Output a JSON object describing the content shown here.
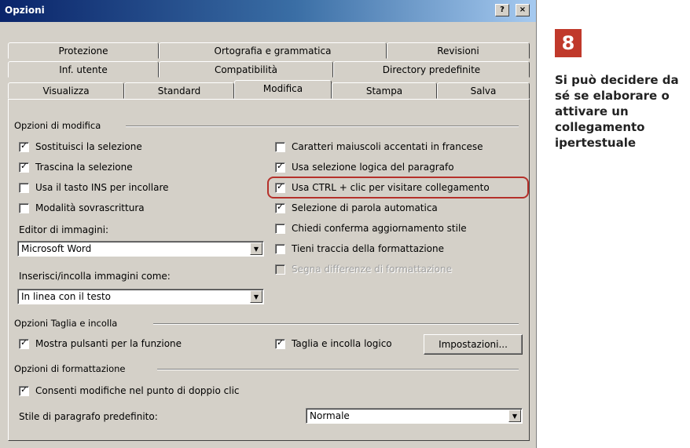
{
  "dialog": {
    "title": "Opzioni",
    "help_button": "?",
    "close_button": "×"
  },
  "tabs": {
    "row1": [
      "Protezione",
      "Ortografia e grammatica",
      "Revisioni"
    ],
    "row2": [
      "Inf. utente",
      "Compatibilità",
      "Directory predefinite"
    ],
    "row3": [
      "Visualizza",
      "Standard",
      "Modifica",
      "Stampa",
      "Salva"
    ],
    "active": "Modifica"
  },
  "groups": {
    "modifica": {
      "title": "Opzioni di modifica",
      "left": [
        {
          "label": "Sostituisci la selezione",
          "checked": true
        },
        {
          "label": "Trascina la selezione",
          "checked": true
        },
        {
          "label": "Usa il tasto INS per incollare",
          "checked": false
        },
        {
          "label": "Modalità sovrascrittura",
          "checked": false
        }
      ],
      "right": [
        {
          "label": "Caratteri maiuscoli accentati in francese",
          "checked": false
        },
        {
          "label": "Usa selezione logica del paragrafo",
          "checked": true
        },
        {
          "label": "Usa CTRL + clic per visitare collegamento",
          "checked": true
        },
        {
          "label": "Selezione di parola automatica",
          "checked": true
        },
        {
          "label": "Chiedi conferma aggiornamento stile",
          "checked": false
        },
        {
          "label": "Tieni traccia della formattazione",
          "checked": false
        },
        {
          "label": "Segna differenze di formattazione",
          "checked": false,
          "disabled": true
        }
      ],
      "editor_label": "Editor di immagini:",
      "editor_value": "Microsoft Word",
      "insert_label": "Inserisci/incolla immagini come:",
      "insert_value": "In linea con il testo"
    },
    "taglia": {
      "title": "Opzioni Taglia e incolla",
      "show_buttons": {
        "label": "Mostra pulsanti per la funzione",
        "checked": true
      },
      "smart_cut": {
        "label": "Taglia e incolla logico",
        "checked": true
      },
      "settings_button": "Impostazioni..."
    },
    "formattazione": {
      "title": "Opzioni di formattazione",
      "double_click": {
        "label": "Consenti modifiche nel punto di doppio clic",
        "checked": true
      },
      "style_label": "Stile di paragrafo predefinito:",
      "style_value": "Normale"
    }
  },
  "callout": {
    "number": "8",
    "text": "Si può decidere da sé se elaborare o attivare un collegamento ipertestuale",
    "accent": "#c0392b"
  },
  "highlight_color": "#b5302a"
}
